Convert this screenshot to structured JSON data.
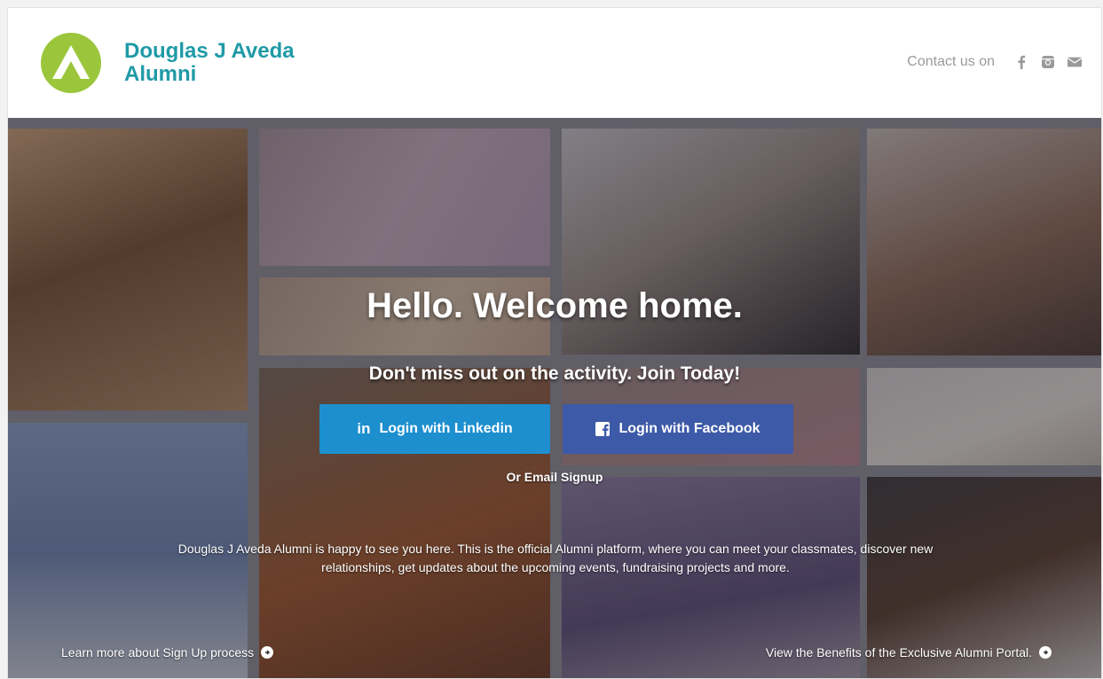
{
  "header": {
    "brand_line1": "Douglas J Aveda",
    "brand_line2": "Alumni",
    "contact_label": "Contact us on",
    "social_icons": [
      "facebook-icon",
      "instagram-icon",
      "envelope-icon"
    ]
  },
  "hero": {
    "title": "Hello. Welcome home.",
    "subtitle": "Don't miss out on the activity. Join Today!",
    "linkedin_button": "Login with Linkedin",
    "facebook_button": "Login with Facebook",
    "email_signup": "Or Email Signup",
    "description": "Douglas J Aveda Alumni is happy to see you here. This is the official Alumni platform, where you can meet your classmates, discover new relationships, get updates about the upcoming events, fundraising projects and more.",
    "learn_more_link": "Learn more about Sign Up process",
    "benefits_link": "View the Benefits of the Exclusive Alumni Portal."
  },
  "colors": {
    "brand_teal": "#1f9aa6",
    "logo_green": "#9bc63b",
    "linkedin_blue": "#1d8fcf",
    "facebook_blue": "#3d5aa8"
  }
}
